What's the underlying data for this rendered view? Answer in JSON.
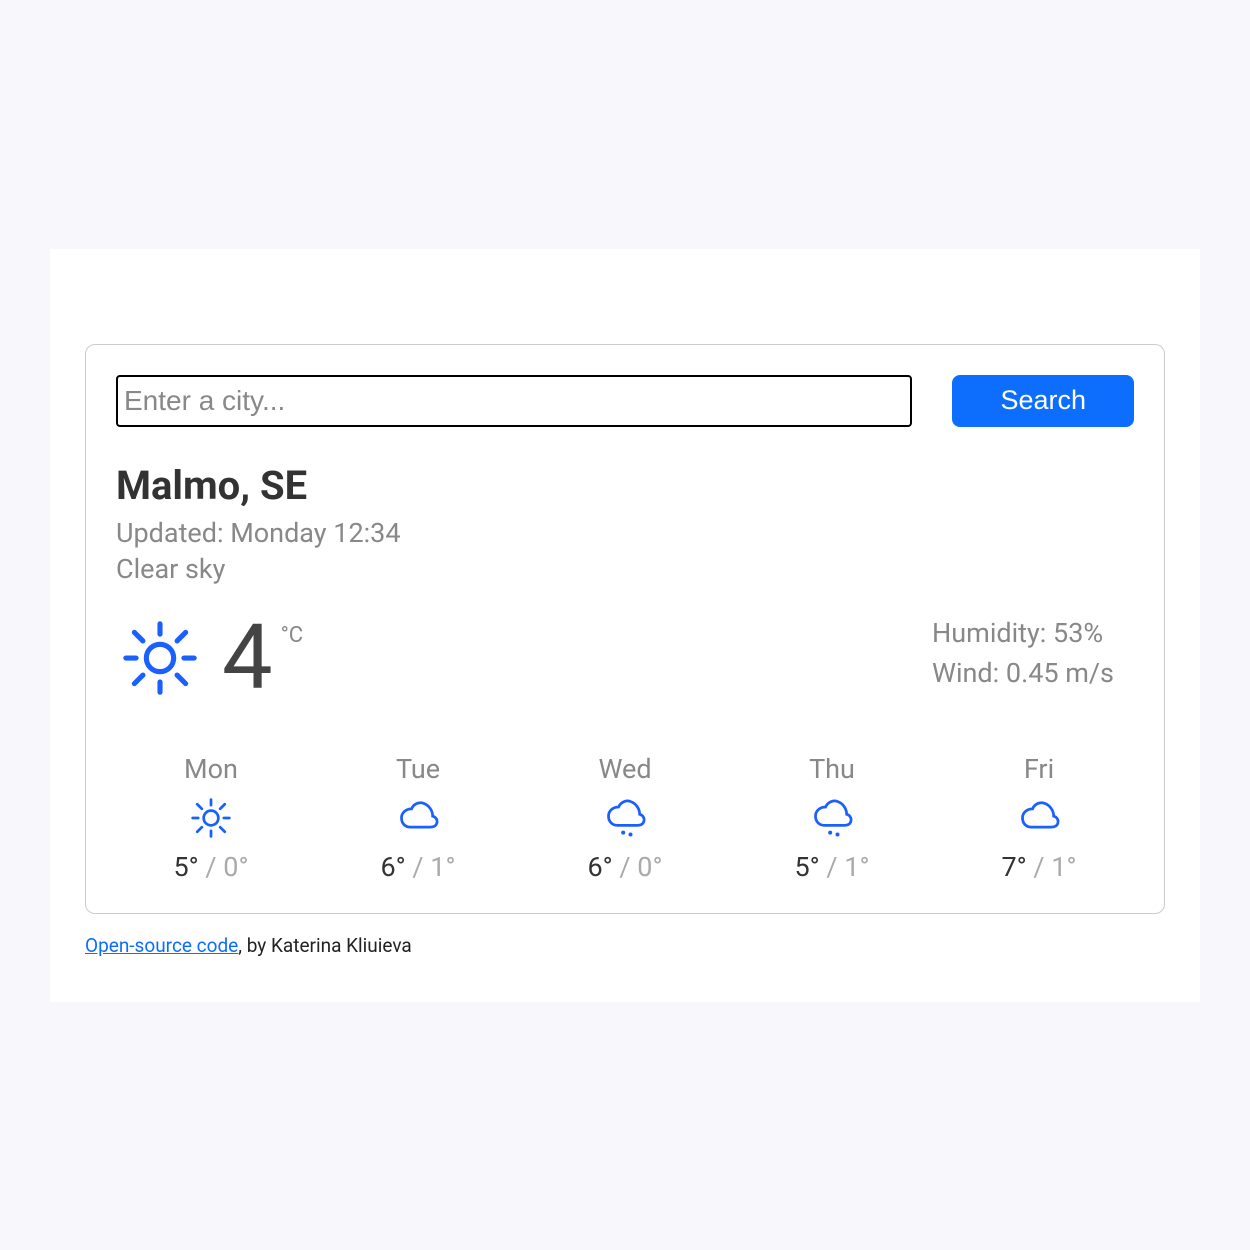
{
  "search": {
    "placeholder": "Enter a city...",
    "button_label": "Search"
  },
  "current": {
    "city": "Malmo, SE",
    "updated": "Updated: Monday 12:34",
    "description": "Clear sky",
    "icon": "sun",
    "temperature": "4",
    "unit": "°C",
    "humidity_label": "Humidity: 53%",
    "wind_label": "Wind: 0.45 m/s"
  },
  "forecast": [
    {
      "day": "Mon",
      "icon": "sun",
      "hi": "5°",
      "lo": "0°"
    },
    {
      "day": "Tue",
      "icon": "cloud",
      "hi": "6°",
      "lo": "1°"
    },
    {
      "day": "Wed",
      "icon": "cloud-drizzle",
      "hi": "6°",
      "lo": "0°"
    },
    {
      "day": "Thu",
      "icon": "cloud-drizzle",
      "hi": "5°",
      "lo": "1°"
    },
    {
      "day": "Fri",
      "icon": "cloud",
      "hi": "7°",
      "lo": "1°"
    }
  ],
  "footer": {
    "link_text": "Open-source code",
    "rest": ", by Katerina Kliuieva"
  }
}
